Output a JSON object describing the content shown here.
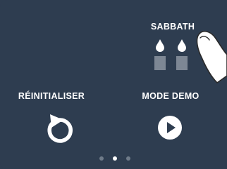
{
  "tiles": {
    "sabbath": {
      "label": "SABBATH",
      "icon": "candles-icon"
    },
    "reset": {
      "label": "RÉINITIALISER",
      "icon": "reset-arrow-icon"
    },
    "demo": {
      "label": "MODE DEMO",
      "icon": "play-icon"
    }
  },
  "pagination": {
    "page_count": 3,
    "active_index": 1
  },
  "colors": {
    "background": "#2e3d50",
    "text": "#ffffff",
    "candle_base": "#7d8794",
    "dot_inactive": "#6f7b89"
  }
}
